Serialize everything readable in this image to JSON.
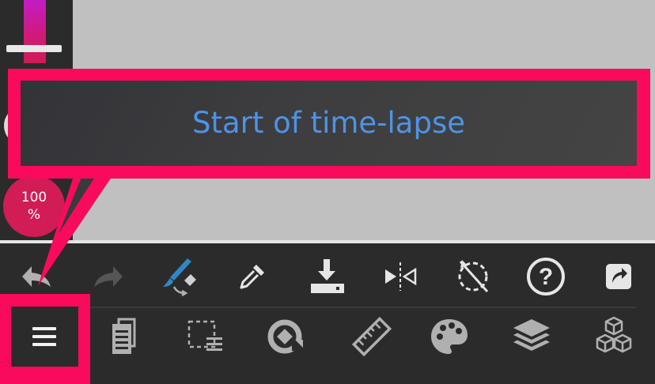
{
  "tooltip": {
    "text": "Start of time-lapse"
  },
  "opacity": {
    "value": "100",
    "unit": "%"
  },
  "colors": {
    "highlight": "#fa0a5c",
    "tooltip_text": "#4e93e7",
    "toolbar_bg": "#2b2b2b",
    "icon": "#b0b0b0",
    "icon_bright": "#e6e6e6",
    "brush_accent": "#2f88c4",
    "canvas": "#c0c0c0"
  },
  "toolbar": {
    "row1": [
      "undo-icon",
      "redo-icon",
      "brush-eraser-icon",
      "eyedropper-icon",
      "download-icon",
      "mirror-icon",
      "rotate-cancel-icon",
      "help-icon",
      "share-icon"
    ],
    "row2": [
      "menu-icon",
      "pages-icon",
      "selection-icon",
      "transform-icon",
      "ruler-icon",
      "palette-icon",
      "layers-icon",
      "materials-icon"
    ]
  }
}
